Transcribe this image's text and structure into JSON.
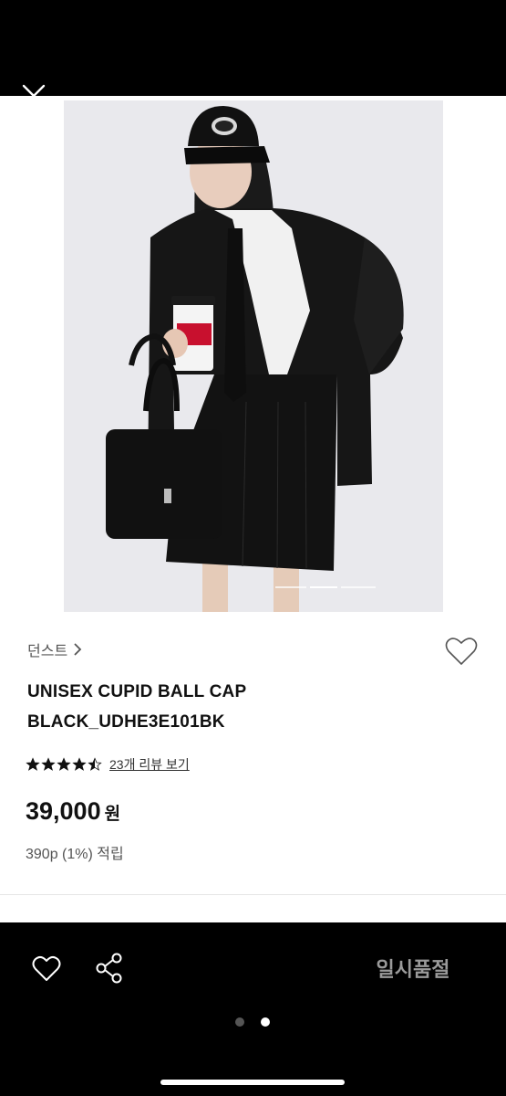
{
  "product": {
    "brand": "던스트",
    "name_line1": "UNISEX CUPID BALL CAP",
    "name_line2": "BLACK_UDHE3E101BK",
    "rating": 4.5,
    "review_link": "23개 리뷰 보기",
    "price": "39,000",
    "price_unit": "원",
    "points": "390p (1%) 적립"
  },
  "actions": {
    "soldout_label": "일시품절"
  },
  "icons": {
    "close": "close-icon",
    "wish": "heart-outline-icon",
    "like": "heart-outline-icon",
    "share": "share-icon",
    "brand_chevron": "chevron-right-icon"
  },
  "pagination": {
    "image_pages": 3,
    "image_current": 2,
    "view_pages": 2,
    "view_current": 2
  },
  "colors": {
    "background_dark": "#000000",
    "sheet": "#ffffff",
    "star": "#111111",
    "soldout_text": "#9a9a9a"
  }
}
